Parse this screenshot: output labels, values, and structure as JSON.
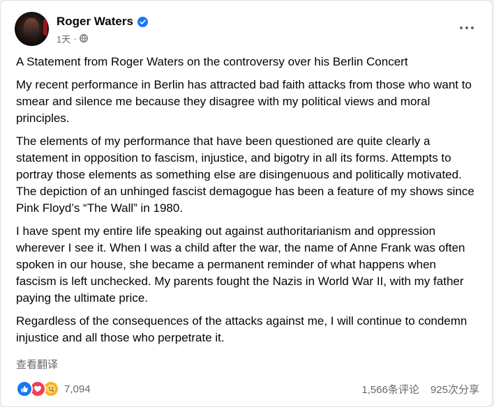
{
  "post": {
    "author": "Roger Waters",
    "time": "1天",
    "separator": "·",
    "paragraphs": [
      "A Statement from Roger Waters on the controversy over his Berlin Concert",
      "My recent performance in Berlin has attracted bad faith attacks from those who want to smear and silence me because they disagree with my political views and moral principles.",
      "The elements of my performance that have been questioned are quite clearly a statement in opposition to fascism, injustice, and bigotry in all its forms. Attempts to portray those elements as something else are disingenuous and politically motivated. The depiction of an unhinged fascist demagogue has been a feature of my shows since Pink Floyd’s “The Wall” in 1980.",
      "I have spent my entire life speaking out against authoritarianism and oppression wherever I see it. When I was a child after the war, the name of Anne Frank was often spoken in our house, she became a permanent reminder of what happens when fascism is left unchecked. My parents fought the Nazis in World War II, with my father paying the ultimate price.",
      "Regardless of the consequences of the attacks against me, I will continue to condemn injustice and all those who perpetrate it."
    ],
    "translate_label": "查看翻译"
  },
  "engagement": {
    "reaction_count": "7,094",
    "comments": "1,566条评论",
    "shares": "925次分享"
  },
  "icons": {
    "verified": "verified-badge-icon",
    "audience": "globe-icon",
    "more": "more-options-icon",
    "reactions": [
      "like-reaction-icon",
      "love-reaction-icon",
      "care-reaction-icon"
    ]
  },
  "colors": {
    "brand_blue": "#1877f2",
    "love_red": "#f33e58",
    "care_yellow": "#f7b125",
    "secondary_text": "#65676b",
    "primary_text": "#050505"
  }
}
